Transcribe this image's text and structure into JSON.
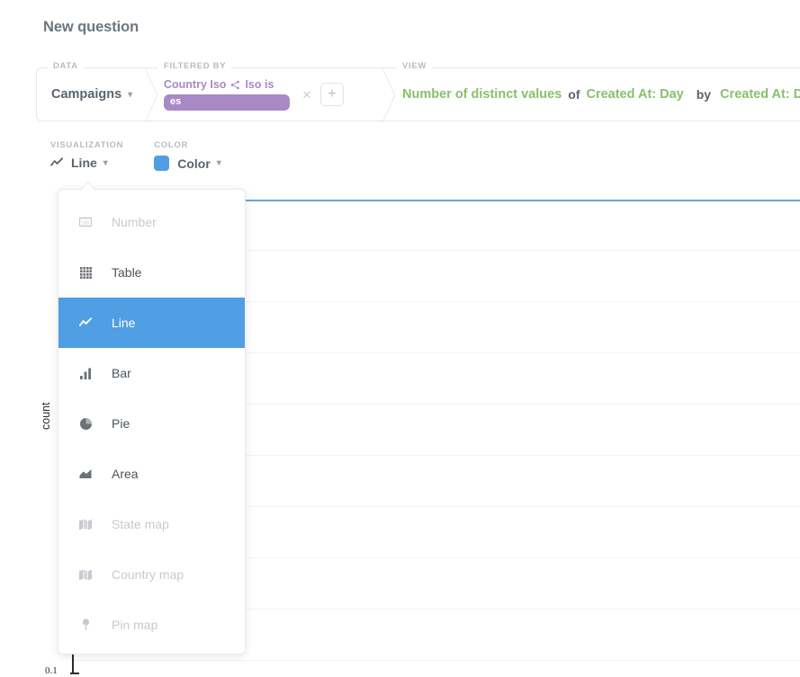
{
  "header": {
    "title": "New question"
  },
  "query_builder": {
    "data": {
      "legend": "DATA",
      "table": "Campaigns",
      "chevron": "chevron-down-icon"
    },
    "filtered_by": {
      "legend": "FILTERED BY",
      "field": "Country Iso",
      "operator": "Iso is",
      "value": "es",
      "remove_label": "×",
      "add_label": "+"
    },
    "view": {
      "legend": "VIEW",
      "aggregation": "Number of distinct values",
      "of_word": "of",
      "aggregation_field": "Created At: Day",
      "by_word": "by",
      "breakout_field": "Created At: Day",
      "remove_label": "×",
      "add_label": "+"
    }
  },
  "settings": {
    "visualization": {
      "legend": "VISUALIZATION",
      "value": "Line",
      "icon": "line-chart-icon",
      "chevron": "chevron-down-icon"
    },
    "color": {
      "legend": "COLOR",
      "value": "Color",
      "swatch_color": "#509ee3",
      "chevron": "chevron-down-icon"
    }
  },
  "visualization_menu": {
    "items": [
      {
        "label": "Number",
        "icon": "number-icon",
        "state": "disabled"
      },
      {
        "label": "Table",
        "icon": "table-icon",
        "state": "enabled"
      },
      {
        "label": "Line",
        "icon": "line-chart-icon",
        "state": "selected"
      },
      {
        "label": "Bar",
        "icon": "bar-chart-icon",
        "state": "enabled"
      },
      {
        "label": "Pie",
        "icon": "pie-chart-icon",
        "state": "enabled"
      },
      {
        "label": "Area",
        "icon": "area-chart-icon",
        "state": "enabled"
      },
      {
        "label": "State map",
        "icon": "map-icon",
        "state": "disabled"
      },
      {
        "label": "Country map",
        "icon": "map-icon",
        "state": "disabled"
      },
      {
        "label": "Pin map",
        "icon": "pin-icon",
        "state": "disabled"
      }
    ]
  },
  "chart_data": {
    "type": "line",
    "title": "",
    "xlabel": "",
    "ylabel": "count",
    "y_tick_labels": [
      "0.1"
    ],
    "series": [
      {
        "name": "count",
        "color": "#6aa7dd",
        "values": [
          1,
          1
        ]
      }
    ],
    "x": [
      0,
      1
    ],
    "ylim": [
      0.1,
      1.05
    ],
    "grid": true,
    "gridline_count": 9,
    "legend_position": "none",
    "note": "Flat line series rendered near the top of the plot area; horizontal gridlines only."
  },
  "colors": {
    "accent_blue": "#509ee3",
    "series_blue": "#6aa7dd",
    "filter_purple": "#a989c5",
    "view_green": "#89c06b",
    "text_grey": "#5a646e",
    "legend_grey": "#b5bcc3"
  }
}
